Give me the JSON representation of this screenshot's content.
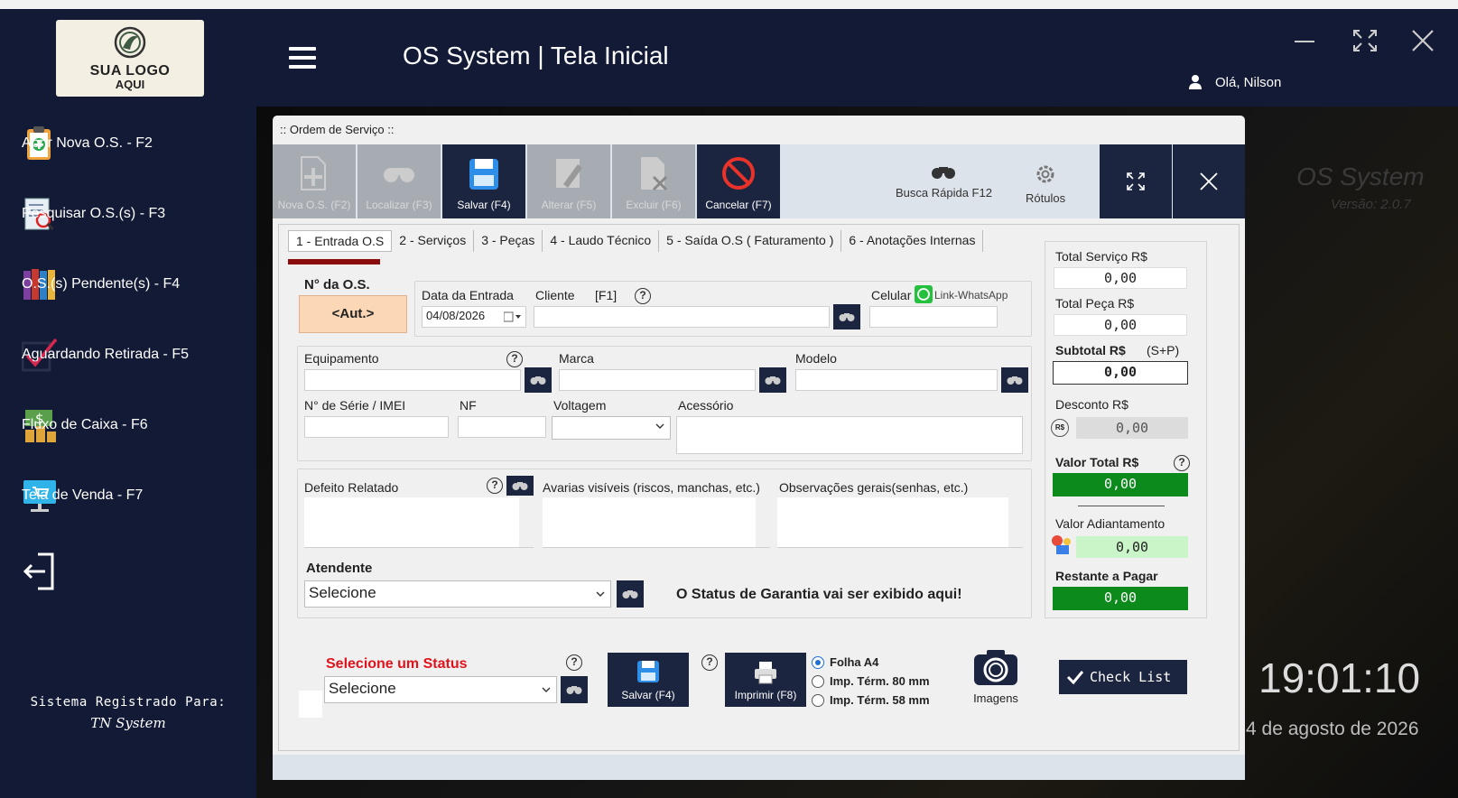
{
  "app": {
    "title": "OS System | Tela Inicial",
    "user_greeting": "Olá, Nilson",
    "brand": "OS System",
    "version": "Versão: 2.0.7",
    "clock_time": "19:01:10",
    "clock_date": "4 de agosto de 2026"
  },
  "logo": {
    "line1": "SUA LOGO",
    "line2": "AQUI"
  },
  "sidebar": {
    "items": [
      {
        "label": "Abrir Nova O.S. - F2",
        "icon": "clipboard-plus-icon"
      },
      {
        "label": "Pesquisar O.S.(s) - F3",
        "icon": "search-document-icon"
      },
      {
        "label": "O.S.(s)  Pendente(s) - F4",
        "icon": "binders-icon"
      },
      {
        "label": "Aguardando Retirada - F5",
        "icon": "checkmark-icon"
      },
      {
        "label": "Fluxo de Caixa - F6",
        "icon": "money-icon"
      },
      {
        "label": "Tela de Venda - F7",
        "icon": "monitor-cart-icon"
      }
    ],
    "registered_label": "Sistema Registrado Para:",
    "registered_to": "TN System"
  },
  "window": {
    "title": ":: Ordem de Serviço ::",
    "toolbar": {
      "nova": "Nova O.S. (F2)",
      "localizar": "Localizar (F3)",
      "salvar": "Salvar (F4)",
      "alterar": "Alterar  (F5)",
      "excluir": "Excluir (F6)",
      "cancelar": "Cancelar (F7)",
      "busca": "Busca Rápida F12",
      "rotulos": "Rótulos"
    },
    "tabs": [
      "1 - Entrada O.S",
      "2 - Serviços",
      "3 - Peças",
      "4 - Laudo Técnico",
      "5 - Saída O.S ( Faturamento )",
      "6 - Anotações Internas"
    ],
    "form": {
      "num_os_label": "N° da O.S.",
      "num_os_value": "<Aut.>",
      "data_entrada_label": "Data da Entrada",
      "data_entrada_value": "04/08/2026",
      "cliente_label": "Cliente",
      "cliente_shortcut": "[F1]",
      "celular_label": "Celular",
      "whatsapp_label": "Link-WhatsApp",
      "equipamento_label": "Equipamento",
      "marca_label": "Marca",
      "modelo_label": "Modelo",
      "serie_label": "N° de Série / IMEI",
      "nf_label": "NF",
      "voltagem_label": "Voltagem",
      "acessorio_label": "Acessório",
      "defeito_label": "Defeito Relatado",
      "avarias_label": "Avarias visíveis (riscos, manchas, etc.)",
      "observacoes_label": "Observações gerais(senhas, etc.)",
      "atendente_label": "Atendente",
      "atendente_value": "Selecione",
      "garantia_status": "O Status de Garantia vai ser exibido aqui!"
    },
    "totals": {
      "servico_label": "Total Serviço R$",
      "servico_value": "0,00",
      "peca_label": "Total Peça R$",
      "peca_value": "0,00",
      "subtotal_label": "Subtotal R$",
      "subtotal_hint": "(S+P)",
      "subtotal_value": "0,00",
      "desconto_label": "Desconto R$",
      "desconto_badge": "R$",
      "desconto_value": "0,00",
      "valor_total_label": "Valor Total R$",
      "valor_total_value": "0,00",
      "adiantamento_label": "Valor Adiantamento",
      "adiantamento_value": "0,00",
      "restante_label": "Restante a Pagar",
      "restante_value": "0,00"
    },
    "bottom": {
      "status_label": "Selecione um Status",
      "status_value": "Selecione",
      "salvar": "Salvar (F4)",
      "imprimir": "Imprimir (F8)",
      "print_options": [
        "Folha A4",
        "Imp. Térm. 80 mm",
        "Imp. Térm. 58 mm"
      ],
      "imagens": "Imagens",
      "checklist": "Check List"
    }
  },
  "colors": {
    "navy": "#121a36",
    "button_dark": "#1c253f",
    "green": "#0c8a1b",
    "red_label": "#e0131c",
    "tab_underline": "#8a0c0c",
    "os_box": "#fbd7b6"
  }
}
